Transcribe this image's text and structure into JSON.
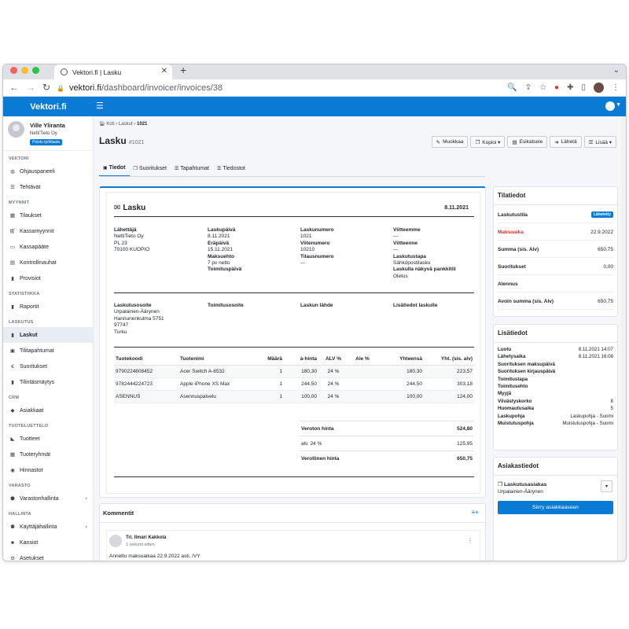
{
  "browser": {
    "tab_title": "Vektori.fi | Lasku",
    "url_host": "vektori.fi",
    "url_path": "/dashboard/invoicer/invoices/38"
  },
  "app": {
    "brand": "Vektori.fi",
    "accent_color": "#0a7bd5"
  },
  "user": {
    "name": "Ville Yliranta",
    "company": "NettiTieto Oy",
    "badge": "Poistu työtilasta"
  },
  "sidebar": {
    "sections": [
      {
        "title": "VEKTORI",
        "items": [
          {
            "label": "Ohjauspaneeli",
            "icon": "palette-icon"
          },
          {
            "label": "Tehtävät",
            "icon": "list-icon"
          }
        ]
      },
      {
        "title": "MYYNNIT",
        "items": [
          {
            "label": "Tilaukset",
            "icon": "table-icon"
          },
          {
            "label": "Kassamyynnit",
            "icon": "cart-icon"
          },
          {
            "label": "Kassapääte",
            "icon": "monitor-icon"
          },
          {
            "label": "Kontrollinauhat",
            "icon": "receipt-icon"
          },
          {
            "label": "Provisiot",
            "icon": "file-icon"
          }
        ]
      },
      {
        "title": "STATISTIIKKA",
        "items": [
          {
            "label": "Raportit",
            "icon": "file-icon"
          }
        ]
      },
      {
        "title": "LASKUTUS",
        "items": [
          {
            "label": "Laskut",
            "icon": "file-icon",
            "active": true
          },
          {
            "label": "Tilitapahtumat",
            "icon": "money-icon"
          },
          {
            "label": "Suoritukset",
            "icon": "euro-icon"
          },
          {
            "label": "Tilintäsmäytys",
            "icon": "file-icon"
          }
        ]
      },
      {
        "title": "CRM",
        "items": [
          {
            "label": "Asiakkaat",
            "icon": "gem-icon"
          }
        ]
      },
      {
        "title": "TUOTELUETTELO",
        "items": [
          {
            "label": "Tuotteet",
            "icon": "tag-icon"
          },
          {
            "label": "Tuoteryhmät",
            "icon": "table-icon"
          },
          {
            "label": "Hinnastot",
            "icon": "dollar-circle-icon"
          }
        ]
      },
      {
        "title": "VARASTO",
        "items": [
          {
            "label": "Varastonhallinta",
            "icon": "box-icon",
            "caret": true
          }
        ]
      },
      {
        "title": "HALLINTA",
        "items": [
          {
            "label": "Käyttäjähallinta",
            "icon": "users-icon",
            "caret": true
          },
          {
            "label": "Kansiot",
            "icon": "folder-icon"
          },
          {
            "label": "Asetukset",
            "icon": "gears-icon"
          }
        ]
      }
    ]
  },
  "breadcrumb": [
    "Koti",
    "Laskut",
    "1021"
  ],
  "page": {
    "title": "Lasku",
    "number": "#1021"
  },
  "toolbar": [
    {
      "label": "Muokkaa",
      "icon": "pencil-icon"
    },
    {
      "label": "Kopioi ▾",
      "icon": "copy-icon"
    },
    {
      "label": "Esikatsele",
      "icon": "document-icon"
    },
    {
      "label": "Lähetä",
      "icon": "send-icon"
    },
    {
      "label": "Lisää ▾",
      "icon": "menu-icon"
    }
  ],
  "tabs": [
    {
      "label": "Tiedot",
      "icon": "info-icon",
      "active": true
    },
    {
      "label": "Suoritukset",
      "icon": "copy-icon"
    },
    {
      "label": "Tapahtumat",
      "icon": "list-icon"
    },
    {
      "label": "Tiedostot",
      "icon": "list-icon"
    }
  ],
  "invoice": {
    "heading": "Lasku",
    "date": "8.11.2021",
    "sender_label": "Lähettäjä",
    "sender_lines": [
      "NettiTieto Oy",
      "PL 23",
      "70100 KUOPIO"
    ],
    "col2": [
      {
        "label": "Laskupäivä",
        "value": "8.11.2021"
      },
      {
        "label": "Eräpäivä",
        "value": "15.11.2021"
      },
      {
        "label": "Maksuehto",
        "value": "7 pv netto"
      },
      {
        "label": "Toimituspäivä",
        "value": ""
      }
    ],
    "col3": [
      {
        "label": "Laskunumero",
        "value": "1021"
      },
      {
        "label": "Viitenumero",
        "value": "10210"
      },
      {
        "label": "Tilausnumero",
        "value": "---"
      }
    ],
    "col4": [
      {
        "label": "Viitteemme",
        "value": "---"
      },
      {
        "label": "Viitteenne",
        "value": "---"
      },
      {
        "label": "Laskutustapa",
        "value": "Sähköpostilasku"
      },
      {
        "label": "Laskulla näkyvä pankkitili",
        "value": "Oletus"
      }
    ],
    "billing_label": "Laskutusosoite",
    "billing_lines": [
      "Urpalainen-Äärynen",
      "Hannunenkulma 5751",
      "97747",
      "Turku"
    ],
    "delivery_label": "Toimitusosoite",
    "source_label": "Laskun lähde",
    "extra_label": "Lisätiedot laskulle",
    "columns": [
      "Tuotekoodi",
      "Tuotenimi",
      "Määrä",
      "à-hinta",
      "ALV %",
      "Ale %",
      "Yhteensä",
      "Yht. (sis. alv)"
    ],
    "rows": [
      [
        "9790224808452",
        "Acer Switch A-8532",
        "1",
        "180,30",
        "24 %",
        "",
        "180,30",
        "223,57"
      ],
      [
        "9782444224723",
        "Apple iPhone XS Max",
        "1",
        "244,50",
        "24 %",
        "",
        "244,50",
        "303,18"
      ],
      [
        "ASENNUS",
        "Asennuspalvelu",
        "1",
        "100,00",
        "24 %",
        "",
        "100,00",
        "124,00"
      ]
    ],
    "totals": [
      {
        "label": "Veroton hinta",
        "value": "524,80",
        "bold": true
      },
      {
        "label": "alv. 24 %",
        "value": "125,95",
        "bold": false
      },
      {
        "label": "Verollinen hinta",
        "value": "650,75",
        "bold": true
      }
    ]
  },
  "comments": {
    "heading": "Kommentit",
    "author": "Tri. Ilmari Kakkola",
    "time": "1 sekunti sitten",
    "text": "Annettu maksuaikaa 22.9.2022 asti. /VY"
  },
  "status": {
    "heading": "Tilatiedot",
    "rows": [
      {
        "label": "Laskutustila",
        "value": "Lähetetty",
        "badge": true
      },
      {
        "label": "Maksuaika",
        "value": "22.9.2022",
        "red": true
      },
      {
        "label": "Summa (sis. Alv)",
        "value": "650,75"
      },
      {
        "label": "Suoritukset",
        "value": "0,00"
      },
      {
        "label": "Alennus",
        "value": ""
      },
      {
        "label": "Avoin summa (sis. Alv)",
        "value": "650,75"
      }
    ]
  },
  "extra": {
    "heading": "Lisätiedot",
    "rows": [
      {
        "label": "Luotu",
        "value": "8.11.2021 14:07"
      },
      {
        "label": "Lähetysaika",
        "value": "8.11.2021 16:08"
      },
      {
        "label": "Suorituksen maksupäivä",
        "value": ""
      },
      {
        "label": "Suorituksen kirjauspäivä",
        "value": ""
      },
      {
        "label": "Toimitustapa",
        "value": ""
      },
      {
        "label": "Toimitusehto",
        "value": ""
      },
      {
        "label": "Myyjä",
        "value": ""
      },
      {
        "label": "Viivästyskorko",
        "value": "8"
      },
      {
        "label": "Huomautusaika",
        "value": "5"
      },
      {
        "label": "Laskupohja",
        "value": "Laskupohja - Suomi"
      },
      {
        "label": "Muistutuspohja",
        "value": "Muistutuspohja - Suomi"
      }
    ]
  },
  "customer": {
    "heading": "Asiakastiedot",
    "title": "Laskutusasiakas",
    "name": "Urpalainen-Äärynen",
    "button": "Siirry asiakkaaseen"
  }
}
